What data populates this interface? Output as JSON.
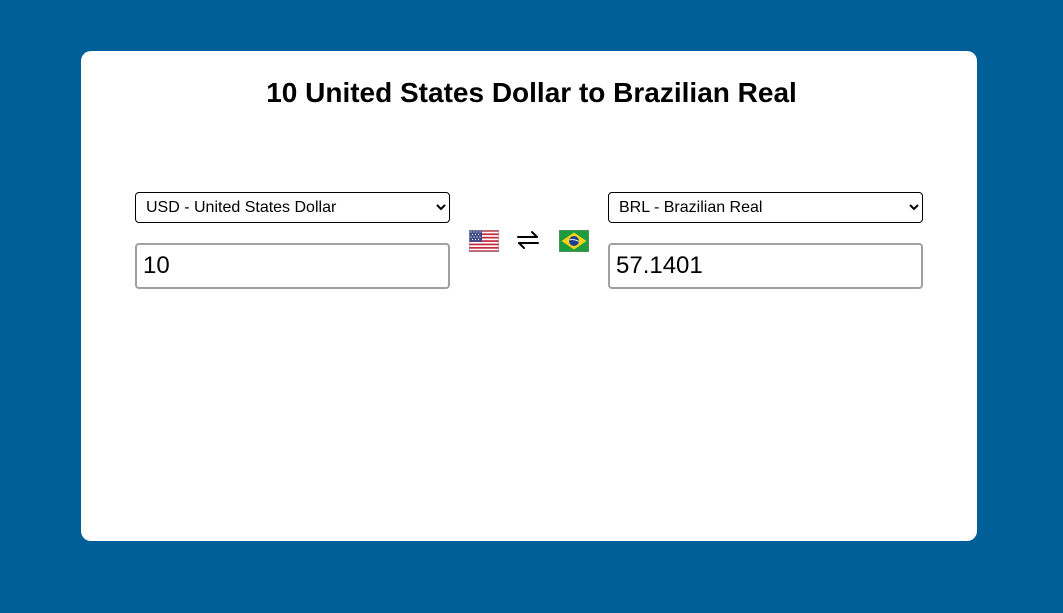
{
  "page": {
    "title": "10 United States Dollar to Brazilian Real"
  },
  "colors": {
    "background": "#005f96",
    "card": "#ffffff"
  },
  "from": {
    "currency_selected": "USD - United States Dollar",
    "amount": "10",
    "flag_icon": "us-flag-icon"
  },
  "to": {
    "currency_selected": "BRL - Brazilian Real",
    "amount": "57.1401",
    "flag_icon": "brazil-flag-icon"
  },
  "swap": {
    "icon": "swap-arrows-icon"
  }
}
